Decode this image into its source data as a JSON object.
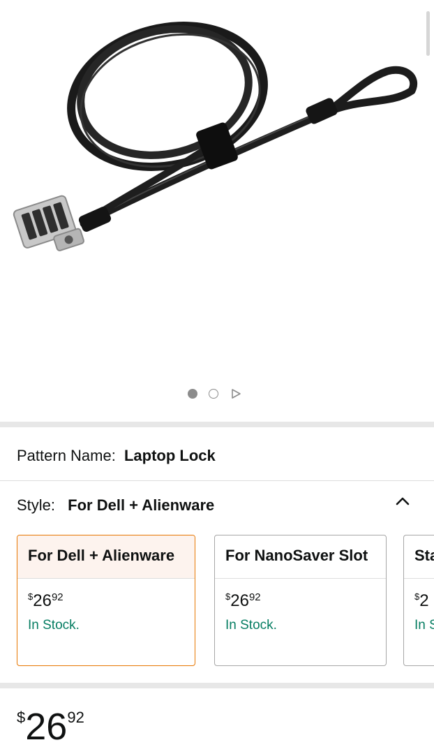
{
  "product_image": {
    "alt_icon": "cable-lock-image"
  },
  "carousel": {
    "dots": [
      "active",
      "idle"
    ],
    "play_icon": "play-icon"
  },
  "pattern": {
    "label": "Pattern Name:",
    "value": "Laptop Lock"
  },
  "style": {
    "label": "Style:",
    "value": "For Dell + Alienware",
    "toggle_icon": "chevron-up-icon"
  },
  "swatches": [
    {
      "title": "For Dell + Alienware",
      "currency": "$",
      "whole": "26",
      "fraction": "92",
      "stock": "In Stock.",
      "selected": true
    },
    {
      "title": "For NanoSaver Slot",
      "currency": "$",
      "whole": "26",
      "fraction": "92",
      "stock": "In Stock.",
      "selected": false
    },
    {
      "title": "Sta",
      "currency": "$",
      "whole": "2",
      "fraction": "",
      "stock": "In S",
      "selected": false
    }
  ],
  "price": {
    "currency": "$",
    "whole": "26",
    "fraction": "92"
  },
  "colors": {
    "selected_border": "#e77600",
    "in_stock": "#067d62",
    "divider": "#e7e7e7"
  }
}
